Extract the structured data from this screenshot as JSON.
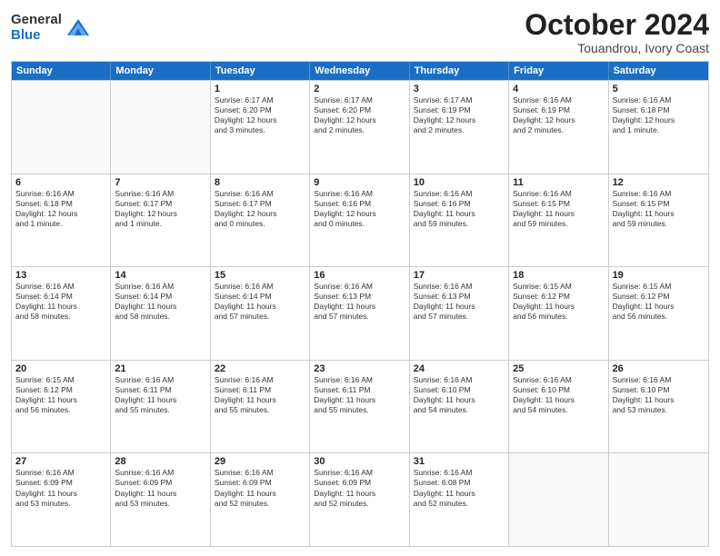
{
  "logo": {
    "general": "General",
    "blue": "Blue"
  },
  "title": "October 2024",
  "subtitle": "Touandrou, Ivory Coast",
  "days": [
    "Sunday",
    "Monday",
    "Tuesday",
    "Wednesday",
    "Thursday",
    "Friday",
    "Saturday"
  ],
  "weeks": [
    [
      {
        "day": "",
        "lines": []
      },
      {
        "day": "",
        "lines": []
      },
      {
        "day": "1",
        "lines": [
          "Sunrise: 6:17 AM",
          "Sunset: 6:20 PM",
          "Daylight: 12 hours",
          "and 3 minutes."
        ]
      },
      {
        "day": "2",
        "lines": [
          "Sunrise: 6:17 AM",
          "Sunset: 6:20 PM",
          "Daylight: 12 hours",
          "and 2 minutes."
        ]
      },
      {
        "day": "3",
        "lines": [
          "Sunrise: 6:17 AM",
          "Sunset: 6:19 PM",
          "Daylight: 12 hours",
          "and 2 minutes."
        ]
      },
      {
        "day": "4",
        "lines": [
          "Sunrise: 6:16 AM",
          "Sunset: 6:19 PM",
          "Daylight: 12 hours",
          "and 2 minutes."
        ]
      },
      {
        "day": "5",
        "lines": [
          "Sunrise: 6:16 AM",
          "Sunset: 6:18 PM",
          "Daylight: 12 hours",
          "and 1 minute."
        ]
      }
    ],
    [
      {
        "day": "6",
        "lines": [
          "Sunrise: 6:16 AM",
          "Sunset: 6:18 PM",
          "Daylight: 12 hours",
          "and 1 minute."
        ]
      },
      {
        "day": "7",
        "lines": [
          "Sunrise: 6:16 AM",
          "Sunset: 6:17 PM",
          "Daylight: 12 hours",
          "and 1 minute."
        ]
      },
      {
        "day": "8",
        "lines": [
          "Sunrise: 6:16 AM",
          "Sunset: 6:17 PM",
          "Daylight: 12 hours",
          "and 0 minutes."
        ]
      },
      {
        "day": "9",
        "lines": [
          "Sunrise: 6:16 AM",
          "Sunset: 6:16 PM",
          "Daylight: 12 hours",
          "and 0 minutes."
        ]
      },
      {
        "day": "10",
        "lines": [
          "Sunrise: 6:16 AM",
          "Sunset: 6:16 PM",
          "Daylight: 11 hours",
          "and 59 minutes."
        ]
      },
      {
        "day": "11",
        "lines": [
          "Sunrise: 6:16 AM",
          "Sunset: 6:15 PM",
          "Daylight: 11 hours",
          "and 59 minutes."
        ]
      },
      {
        "day": "12",
        "lines": [
          "Sunrise: 6:16 AM",
          "Sunset: 6:15 PM",
          "Daylight: 11 hours",
          "and 59 minutes."
        ]
      }
    ],
    [
      {
        "day": "13",
        "lines": [
          "Sunrise: 6:16 AM",
          "Sunset: 6:14 PM",
          "Daylight: 11 hours",
          "and 58 minutes."
        ]
      },
      {
        "day": "14",
        "lines": [
          "Sunrise: 6:16 AM",
          "Sunset: 6:14 PM",
          "Daylight: 11 hours",
          "and 58 minutes."
        ]
      },
      {
        "day": "15",
        "lines": [
          "Sunrise: 6:16 AM",
          "Sunset: 6:14 PM",
          "Daylight: 11 hours",
          "and 57 minutes."
        ]
      },
      {
        "day": "16",
        "lines": [
          "Sunrise: 6:16 AM",
          "Sunset: 6:13 PM",
          "Daylight: 11 hours",
          "and 57 minutes."
        ]
      },
      {
        "day": "17",
        "lines": [
          "Sunrise: 6:16 AM",
          "Sunset: 6:13 PM",
          "Daylight: 11 hours",
          "and 57 minutes."
        ]
      },
      {
        "day": "18",
        "lines": [
          "Sunrise: 6:15 AM",
          "Sunset: 6:12 PM",
          "Daylight: 11 hours",
          "and 56 minutes."
        ]
      },
      {
        "day": "19",
        "lines": [
          "Sunrise: 6:15 AM",
          "Sunset: 6:12 PM",
          "Daylight: 11 hours",
          "and 56 minutes."
        ]
      }
    ],
    [
      {
        "day": "20",
        "lines": [
          "Sunrise: 6:15 AM",
          "Sunset: 6:12 PM",
          "Daylight: 11 hours",
          "and 56 minutes."
        ]
      },
      {
        "day": "21",
        "lines": [
          "Sunrise: 6:16 AM",
          "Sunset: 6:11 PM",
          "Daylight: 11 hours",
          "and 55 minutes."
        ]
      },
      {
        "day": "22",
        "lines": [
          "Sunrise: 6:16 AM",
          "Sunset: 6:11 PM",
          "Daylight: 11 hours",
          "and 55 minutes."
        ]
      },
      {
        "day": "23",
        "lines": [
          "Sunrise: 6:16 AM",
          "Sunset: 6:11 PM",
          "Daylight: 11 hours",
          "and 55 minutes."
        ]
      },
      {
        "day": "24",
        "lines": [
          "Sunrise: 6:16 AM",
          "Sunset: 6:10 PM",
          "Daylight: 11 hours",
          "and 54 minutes."
        ]
      },
      {
        "day": "25",
        "lines": [
          "Sunrise: 6:16 AM",
          "Sunset: 6:10 PM",
          "Daylight: 11 hours",
          "and 54 minutes."
        ]
      },
      {
        "day": "26",
        "lines": [
          "Sunrise: 6:16 AM",
          "Sunset: 6:10 PM",
          "Daylight: 11 hours",
          "and 53 minutes."
        ]
      }
    ],
    [
      {
        "day": "27",
        "lines": [
          "Sunrise: 6:16 AM",
          "Sunset: 6:09 PM",
          "Daylight: 11 hours",
          "and 53 minutes."
        ]
      },
      {
        "day": "28",
        "lines": [
          "Sunrise: 6:16 AM",
          "Sunset: 6:09 PM",
          "Daylight: 11 hours",
          "and 53 minutes."
        ]
      },
      {
        "day": "29",
        "lines": [
          "Sunrise: 6:16 AM",
          "Sunset: 6:09 PM",
          "Daylight: 11 hours",
          "and 52 minutes."
        ]
      },
      {
        "day": "30",
        "lines": [
          "Sunrise: 6:16 AM",
          "Sunset: 6:09 PM",
          "Daylight: 11 hours",
          "and 52 minutes."
        ]
      },
      {
        "day": "31",
        "lines": [
          "Sunrise: 6:16 AM",
          "Sunset: 6:08 PM",
          "Daylight: 11 hours",
          "and 52 minutes."
        ]
      },
      {
        "day": "",
        "lines": []
      },
      {
        "day": "",
        "lines": []
      }
    ]
  ]
}
